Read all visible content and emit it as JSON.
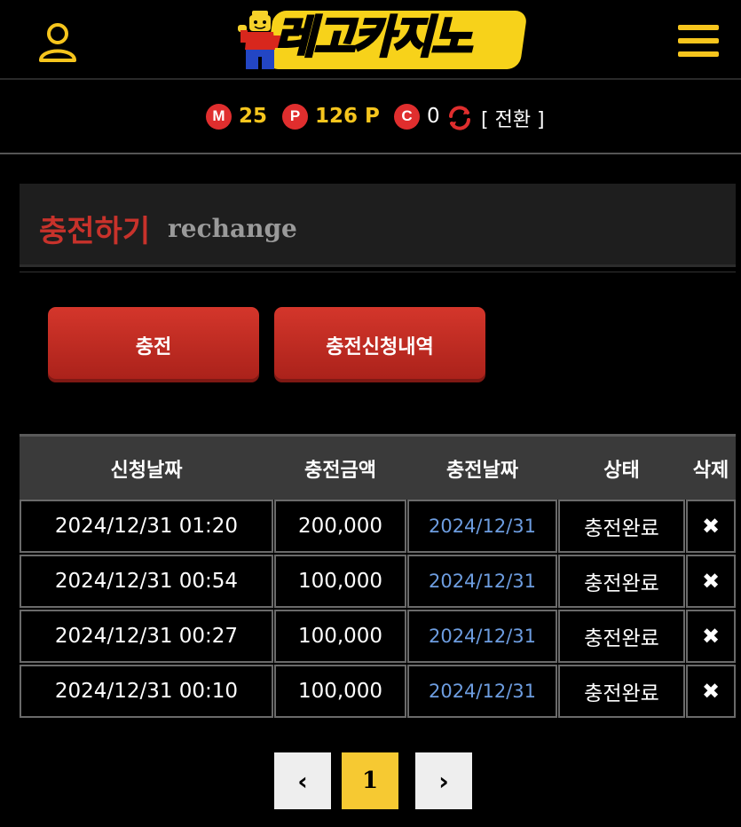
{
  "header": {
    "logo_text": "레고카지노"
  },
  "balances": {
    "m": {
      "badge": "M",
      "value": "25"
    },
    "p": {
      "badge": "P",
      "value": "126 P"
    },
    "c": {
      "badge": "C",
      "value": "0"
    },
    "swap_label": "[ 전환 ]"
  },
  "section": {
    "title": "충전하기",
    "subtitle": "rechange"
  },
  "buttons": {
    "charge": "충전",
    "history": "충전신청내역"
  },
  "table": {
    "headers": [
      "신청날짜",
      "충전금액",
      "충전날짜",
      "상태",
      "삭제"
    ],
    "rows": [
      {
        "requested": "2024/12/31 01:20",
        "amount": "200,000",
        "charged": "2024/12/31",
        "status": "충전완료",
        "delete": "✖"
      },
      {
        "requested": "2024/12/31 00:54",
        "amount": "100,000",
        "charged": "2024/12/31",
        "status": "충전완료",
        "delete": "✖"
      },
      {
        "requested": "2024/12/31 00:27",
        "amount": "100,000",
        "charged": "2024/12/31",
        "status": "충전완료",
        "delete": "✖"
      },
      {
        "requested": "2024/12/31 00:10",
        "amount": "100,000",
        "charged": "2024/12/31",
        "status": "충전완료",
        "delete": "✖"
      }
    ]
  },
  "pagination": {
    "prev": "‹",
    "current": "1",
    "next": "›"
  },
  "colors": {
    "accent_yellow": "#f6c51d",
    "accent_red": "#c8322b",
    "link_blue": "#6d9de0"
  }
}
